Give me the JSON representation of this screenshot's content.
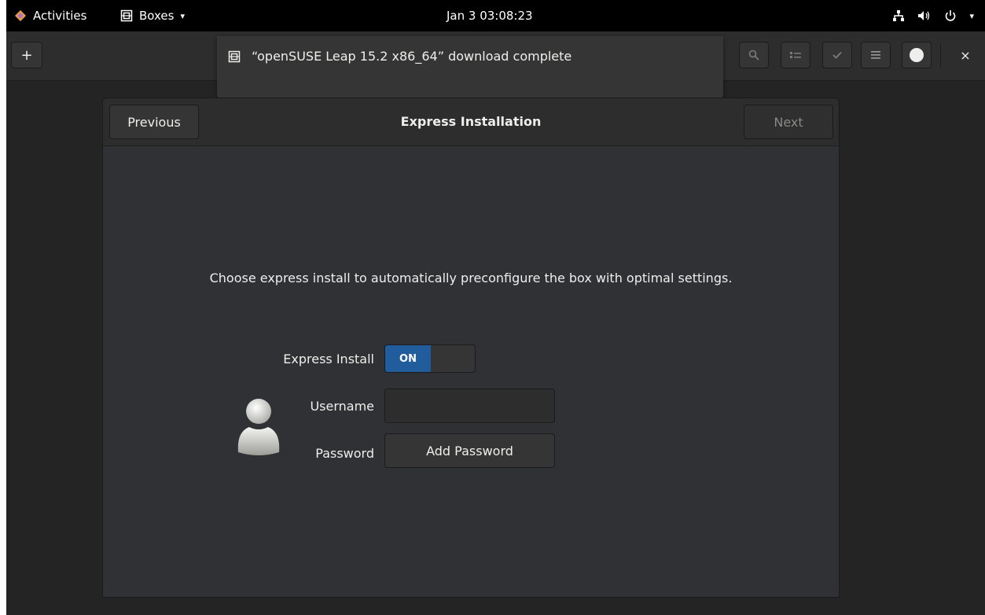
{
  "topbar": {
    "activities_label": "Activities",
    "app_label": "Boxes",
    "clock": "Jan 3  03:08:23",
    "caret": "▾"
  },
  "headerbar": {
    "new_label": "+",
    "close_label": "×"
  },
  "notification": {
    "message": "“openSUSE Leap 15.2 x86_64” download complete"
  },
  "dialog": {
    "previous_label": "Previous",
    "title": "Express Installation",
    "next_label": "Next",
    "description": "Choose express install to automatically preconfigure the box with optimal settings.",
    "express_label": "Express Install",
    "switch_state": "ON",
    "username_label": "Username",
    "username_value": "",
    "password_label": "Password",
    "add_password_label": "Add Password"
  },
  "colors": {
    "accent": "#215d9c",
    "background": "#242424",
    "dialog_bg": "#2f3134"
  }
}
